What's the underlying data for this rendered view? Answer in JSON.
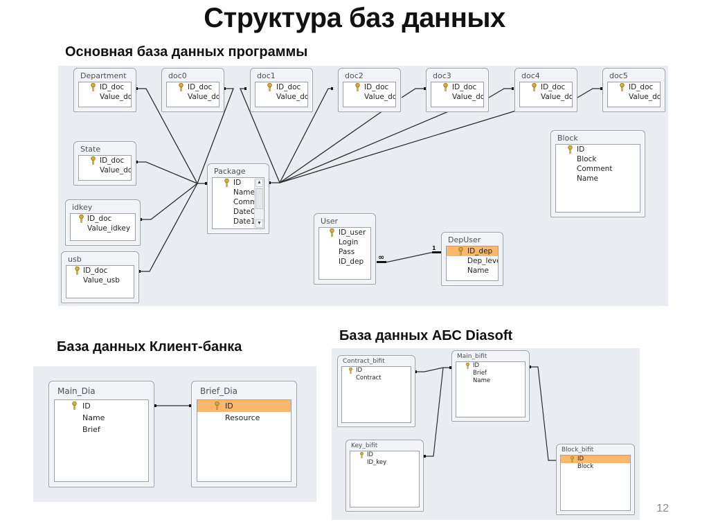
{
  "slide": {
    "title": "Структура баз данных",
    "page_number": "12"
  },
  "main_db": {
    "heading": "Основная база данных программы",
    "tables": {
      "department": {
        "name": "Department",
        "fields": [
          {
            "label": "ID_doc",
            "pk": true
          },
          {
            "label": "Value_do"
          }
        ]
      },
      "doc0": {
        "name": "doc0",
        "fields": [
          {
            "label": "ID_doc",
            "pk": true
          },
          {
            "label": "Value_do"
          }
        ]
      },
      "doc1": {
        "name": "doc1",
        "fields": [
          {
            "label": "ID_doc",
            "pk": true
          },
          {
            "label": "Value_do"
          }
        ]
      },
      "doc2": {
        "name": "doc2",
        "fields": [
          {
            "label": "ID_doc",
            "pk": true
          },
          {
            "label": "Value_do"
          }
        ]
      },
      "doc3": {
        "name": "doc3",
        "fields": [
          {
            "label": "ID_doc",
            "pk": true
          },
          {
            "label": "Value_do"
          }
        ]
      },
      "doc4": {
        "name": "doc4",
        "fields": [
          {
            "label": "ID_doc",
            "pk": true
          },
          {
            "label": "Value_do"
          }
        ]
      },
      "doc5": {
        "name": "doc5",
        "fields": [
          {
            "label": "ID_doc",
            "pk": true
          },
          {
            "label": "Value_do"
          }
        ]
      },
      "state": {
        "name": "State",
        "fields": [
          {
            "label": "ID_doc",
            "pk": true
          },
          {
            "label": "Value_do"
          }
        ]
      },
      "idkey": {
        "name": "idkey",
        "fields": [
          {
            "label": "ID_doc",
            "pk": true
          },
          {
            "label": "Value_idkey"
          }
        ]
      },
      "usb": {
        "name": "usb",
        "fields": [
          {
            "label": "ID_doc",
            "pk": true
          },
          {
            "label": "Value_usb"
          }
        ]
      },
      "package": {
        "name": "Package",
        "fields": [
          {
            "label": "ID",
            "pk": true
          },
          {
            "label": "Name"
          },
          {
            "label": "Comm"
          },
          {
            "label": "Date0"
          },
          {
            "label": "Date1"
          }
        ]
      },
      "block": {
        "name": "Block",
        "fields": [
          {
            "label": "ID",
            "pk": true
          },
          {
            "label": "Block"
          },
          {
            "label": "Comment"
          },
          {
            "label": "Name"
          }
        ]
      },
      "user": {
        "name": "User",
        "fields": [
          {
            "label": "ID_user",
            "pk": true
          },
          {
            "label": "Login"
          },
          {
            "label": "Pass"
          },
          {
            "label": "ID_dep"
          }
        ]
      },
      "depuser": {
        "name": "DepUser",
        "fields": [
          {
            "label": "ID_dep",
            "pk": true,
            "selected": true
          },
          {
            "label": "Dep_level"
          },
          {
            "label": "Name"
          }
        ]
      }
    },
    "relation_labels": {
      "many": "∞",
      "one": "1"
    }
  },
  "client_bank_db": {
    "heading": "База данных Клиент-банка",
    "tables": {
      "main_dia": {
        "name": "Main_Dia",
        "fields": [
          {
            "label": "ID",
            "pk": true
          },
          {
            "label": "Name"
          },
          {
            "label": "Brief"
          }
        ]
      },
      "brief_dia": {
        "name": "Brief_Dia",
        "fields": [
          {
            "label": "ID",
            "pk": true,
            "selected": true
          },
          {
            "label": "Resource"
          }
        ]
      }
    }
  },
  "diasoft_db": {
    "heading": "База данных АБС Diasoft",
    "tables": {
      "contract_bifit": {
        "name": "Contract_bifit",
        "fields": [
          {
            "label": "ID",
            "pk": true
          },
          {
            "label": "Contract"
          }
        ]
      },
      "main_bifit": {
        "name": "Main_bifit",
        "fields": [
          {
            "label": "ID",
            "pk": true
          },
          {
            "label": "Brief"
          },
          {
            "label": "Name"
          }
        ]
      },
      "key_bifit": {
        "name": "Key_bifit",
        "fields": [
          {
            "label": "ID",
            "pk": true
          },
          {
            "label": "ID_key"
          }
        ]
      },
      "block_bifit": {
        "name": "Block_bifit",
        "fields": [
          {
            "label": "ID",
            "pk": true,
            "selected": true
          },
          {
            "label": "Block"
          }
        ]
      }
    }
  },
  "colors": {
    "panel_bg": "#e9ecf0",
    "selected_row": "#fbb86a",
    "line": "#2a2a2a",
    "key_icon": "#c9a227"
  }
}
